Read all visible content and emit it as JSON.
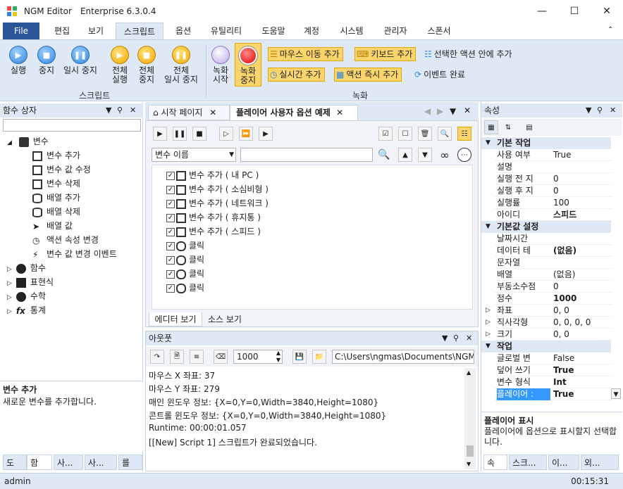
{
  "window": {
    "app_name": "NGM Editor",
    "edition": "Enterprise 6.3.0.4"
  },
  "menu": {
    "file": "File",
    "tabs": [
      "편집",
      "보기",
      "스크립트",
      "옵션",
      "유틸리티",
      "도움말",
      "계정",
      "시스템",
      "관리자",
      "스폰서"
    ]
  },
  "ribbon": {
    "run": "실행",
    "stop": "중지",
    "pause": "일시 중지",
    "run_all_1": "전체",
    "run_all_2": "실행",
    "stop_all_1": "전체",
    "stop_all_2": "중지",
    "pause_all_1": "전체",
    "pause_all_2": "일시 중지",
    "record_1": "녹화",
    "record_2": "시작",
    "rec_stop_1": "녹화",
    "rec_stop_2": "중지",
    "mouse_move": "마우스 이동 추가",
    "keyboard": "키보드 추가",
    "inside_action": "선택한 액션 안에 추가",
    "realtime": "실시간 추가",
    "action_now": "액션 즉시 추가",
    "event_done": "이벤트 완료",
    "group_script": "스크립트",
    "group_record": "녹화"
  },
  "left_panel": {
    "title": "함수 상자",
    "tree": {
      "variables": "변수",
      "children": [
        "변수 추가",
        "변수 값 수정",
        "변수 삭제",
        "배열 추가",
        "배열 삭제",
        "배열 값",
        "액션 속성 변경",
        "변수 값 변경 이벤트"
      ],
      "others": [
        "함수",
        "표현식",
        "수학",
        "통계"
      ]
    },
    "desc_title": "변수 추가",
    "desc_text": "새로운 변수를 추가합니다.",
    "bottom_tabs": [
      "도",
      "함",
      "사...",
      "사...",
      "를"
    ]
  },
  "editor": {
    "tab_start": "시작 페이지",
    "tab_active": "플레이어 사용자 옵션 예제",
    "search_combo": "변수 이름",
    "items": [
      "변수 추가 ( 내 PC )",
      "변수 추가 ( 소심비형 )",
      "변수 추가 ( 네트워크 )",
      "변수 추가 ( 휴지통 )",
      "변수 추가 ( 스피드 )",
      "클릭",
      "클릭",
      "클릭",
      "클릭"
    ],
    "view_editor": "에디터 보기",
    "view_source": "소스 보기"
  },
  "output": {
    "title": "아웃풋",
    "interval": "1000",
    "path": "C:\\Users\\ngmas\\Documents\\NGM6\\",
    "lines": [
      "마우스 X 좌표: 37",
      "마우스 Y 좌표: 279",
      "매인 윈도우 정보: {X=0,Y=0,Width=3840,Height=1080}",
      "콘트롤 윈도우 정보: {X=0,Y=0,Width=3840,Height=1080}",
      "Runtime: 00:00:01.057",
      "[[New] Script 1] 스크립트가 완료되었습니다."
    ]
  },
  "properties": {
    "title": "속성",
    "cat_basic": "기본 작업",
    "basic": [
      [
        "사용 여부",
        "True"
      ],
      [
        "설명",
        ""
      ],
      [
        "실행 전 지",
        "0"
      ],
      [
        "실행 후 지",
        "0"
      ],
      [
        "실행률",
        "100"
      ],
      [
        "아이디",
        "스피드"
      ]
    ],
    "cat_default": "기본값 설정",
    "defaults": [
      [
        "날짜시간",
        ""
      ],
      [
        "데이터 테",
        "(없음)"
      ],
      [
        "문자열",
        ""
      ],
      [
        "배열",
        "(없음)"
      ],
      [
        "부동소수점",
        "0"
      ],
      [
        "정수",
        "1000"
      ],
      [
        "좌표",
        "0, 0"
      ],
      [
        "직사각형",
        "0, 0, 0, 0"
      ],
      [
        "크기",
        "0, 0"
      ]
    ],
    "cat_work": "작업",
    "work": [
      [
        "글로벌 변",
        "False"
      ],
      [
        "덮어 쓰기",
        "True"
      ],
      [
        "변수 형식",
        "Int"
      ],
      [
        "플레이어 :",
        "True"
      ]
    ],
    "desc_title": "플레이어 표시",
    "desc_text": "플레이어에 옵션으로 표시할지 선택합니다.",
    "bottom_tabs": [
      "속",
      "스크...",
      "이...",
      "외..."
    ]
  },
  "status": {
    "user": "admin",
    "time": "00:15:31"
  }
}
